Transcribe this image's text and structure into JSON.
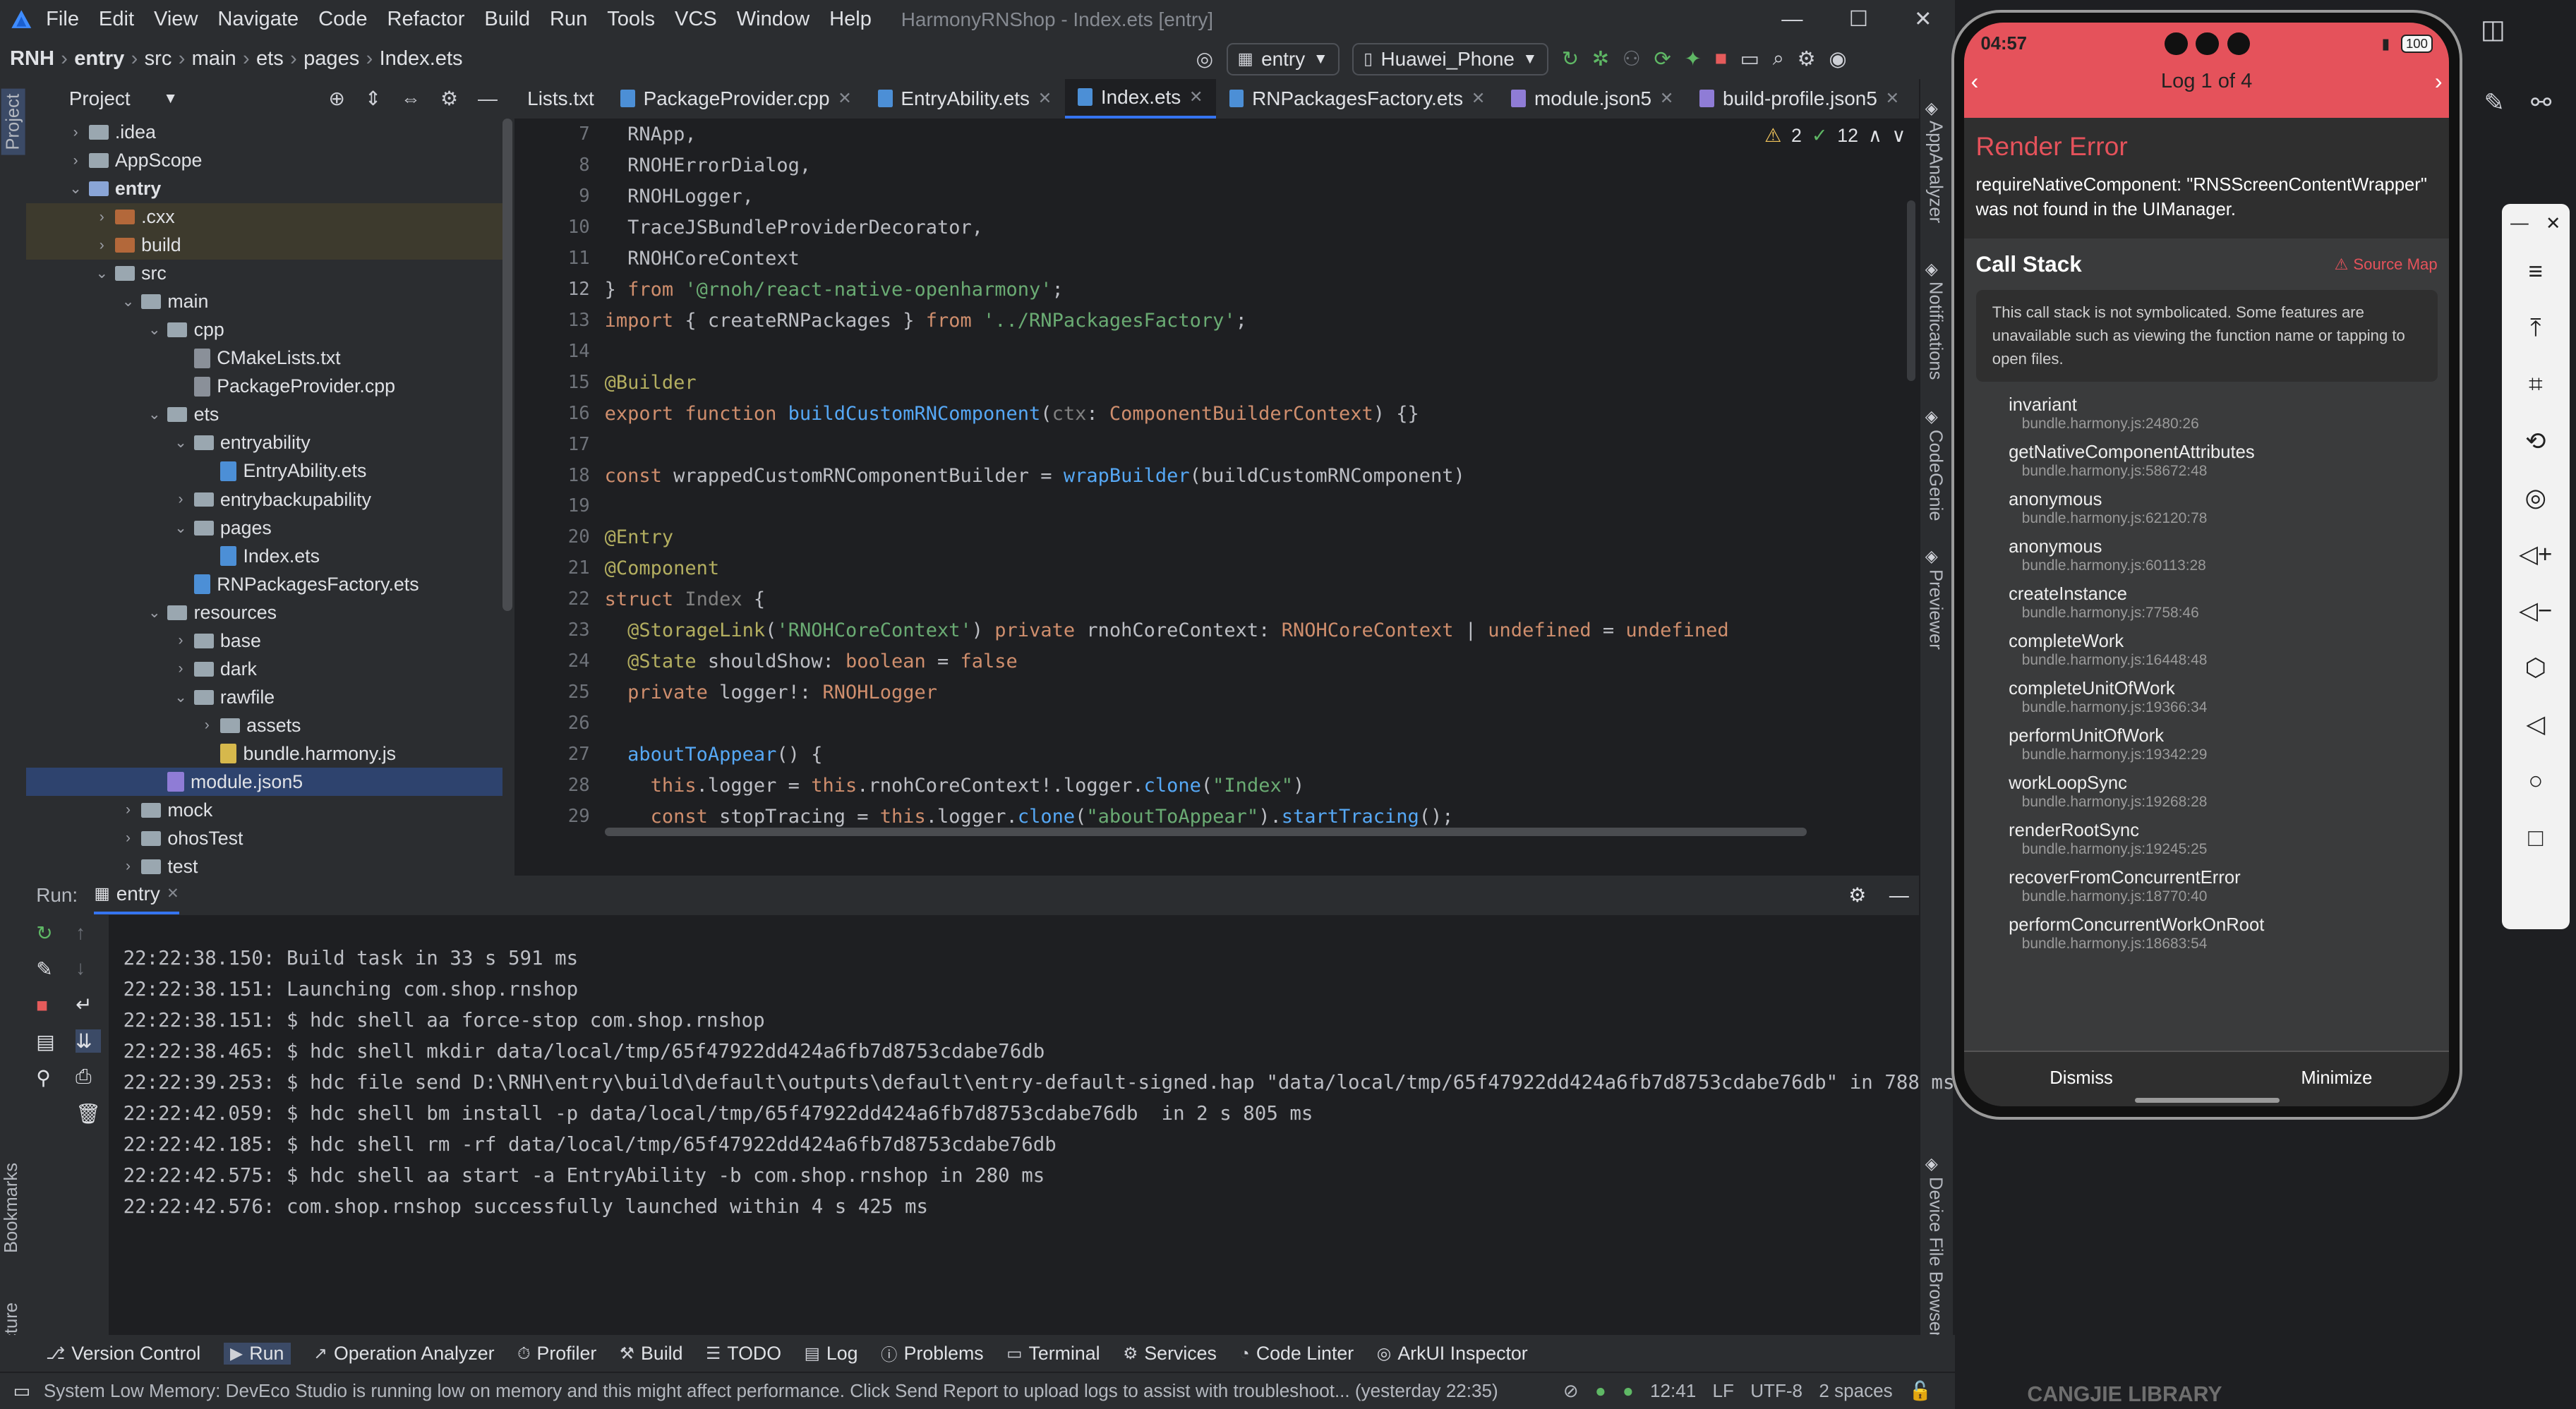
{
  "window": {
    "title": "HarmonyRNShop - Index.ets [entry]",
    "menu": [
      "File",
      "Edit",
      "View",
      "Navigate",
      "Code",
      "Refactor",
      "Build",
      "Run",
      "Tools",
      "VCS",
      "Window",
      "Help"
    ]
  },
  "breadcrumb": [
    "RNH",
    "entry",
    "src",
    "main",
    "ets",
    "pages",
    "Index.ets"
  ],
  "toolbar": {
    "run_config": "entry",
    "device": "Huawei_Phone"
  },
  "project": {
    "title": "Project",
    "tree": [
      {
        "label": ".idea",
        "depth": 1,
        "caret": "›",
        "kind": "folder"
      },
      {
        "label": "AppScope",
        "depth": 1,
        "caret": "›",
        "kind": "folder"
      },
      {
        "label": "entry",
        "depth": 1,
        "caret": "⌄",
        "kind": "module",
        "bold": true
      },
      {
        "label": ".cxx",
        "depth": 2,
        "caret": "›",
        "kind": "excluded"
      },
      {
        "label": "build",
        "depth": 2,
        "caret": "›",
        "kind": "excluded"
      },
      {
        "label": "src",
        "depth": 2,
        "caret": "⌄",
        "kind": "folder"
      },
      {
        "label": "main",
        "depth": 3,
        "caret": "⌄",
        "kind": "folder"
      },
      {
        "label": "cpp",
        "depth": 4,
        "caret": "⌄",
        "kind": "folder"
      },
      {
        "label": "CMakeLists.txt",
        "depth": 5,
        "caret": "",
        "kind": "file"
      },
      {
        "label": "PackageProvider.cpp",
        "depth": 5,
        "caret": "",
        "kind": "file"
      },
      {
        "label": "ets",
        "depth": 4,
        "caret": "⌄",
        "kind": "folder"
      },
      {
        "label": "entryability",
        "depth": 5,
        "caret": "⌄",
        "kind": "folder"
      },
      {
        "label": "EntryAbility.ets",
        "depth": 6,
        "caret": "",
        "kind": "file"
      },
      {
        "label": "entrybackupability",
        "depth": 5,
        "caret": "›",
        "kind": "folder"
      },
      {
        "label": "pages",
        "depth": 5,
        "caret": "⌄",
        "kind": "folder"
      },
      {
        "label": "Index.ets",
        "depth": 6,
        "caret": "",
        "kind": "file"
      },
      {
        "label": "RNPackagesFactory.ets",
        "depth": 5,
        "caret": "",
        "kind": "file"
      },
      {
        "label": "resources",
        "depth": 4,
        "caret": "⌄",
        "kind": "folder"
      },
      {
        "label": "base",
        "depth": 5,
        "caret": "›",
        "kind": "folder"
      },
      {
        "label": "dark",
        "depth": 5,
        "caret": "›",
        "kind": "folder"
      },
      {
        "label": "rawfile",
        "depth": 5,
        "caret": "⌄",
        "kind": "folder"
      },
      {
        "label": "assets",
        "depth": 6,
        "caret": "›",
        "kind": "folder"
      },
      {
        "label": "bundle.harmony.js",
        "depth": 6,
        "caret": "",
        "kind": "file"
      },
      {
        "label": "module.json5",
        "depth": 4,
        "caret": "",
        "kind": "file",
        "selected": true
      },
      {
        "label": "mock",
        "depth": 3,
        "caret": "›",
        "kind": "folder"
      },
      {
        "label": "ohosTest",
        "depth": 3,
        "caret": "›",
        "kind": "folder"
      },
      {
        "label": "test",
        "depth": 3,
        "caret": "›",
        "kind": "folder"
      }
    ]
  },
  "editor": {
    "tabs": [
      "Lists.txt",
      "PackageProvider.cpp",
      "EntryAbility.ets",
      "Index.ets",
      "RNPackagesFactory.ets",
      "module.json5",
      "build-profile.json5"
    ],
    "active_tab": "Index.ets",
    "inspections": {
      "warnings": "2",
      "ok": "12"
    },
    "lines": [
      {
        "n": "7",
        "html": "  <span class='plain'>RNApp,</span>"
      },
      {
        "n": "8",
        "html": "  <span class='plain'>RNOHErrorDialog,</span>"
      },
      {
        "n": "9",
        "html": "  <span class='plain'>RNOHLogger,</span>"
      },
      {
        "n": "10",
        "html": "  <span class='plain'>TraceJSBundleProviderDecorator,</span>"
      },
      {
        "n": "11",
        "html": "  <span class='plain'>RNOHCoreContext</span>"
      },
      {
        "n": "12",
        "html": "<span class='plain'>} </span><span class='kw'>from </span><span class='str'>'@rnoh/react-native-openharmony'</span><span class='plain'>;</span>"
      },
      {
        "n": "13",
        "html": "<span class='kw'>import </span><span class='plain'>{ createRNPackages } </span><span class='kw'>from </span><span class='str'>'../RNPackagesFactory'</span><span class='plain'>;</span>"
      },
      {
        "n": "14",
        "html": ""
      },
      {
        "n": "15",
        "html": "<span class='dec'>@Builder</span>"
      },
      {
        "n": "16",
        "html": "<span class='kw'>export function </span><span class='fn'>buildCustomRNComponent</span><span class='plain'>(</span><span class='par'>ctx</span><span class='plain'>: </span><span class='kw'>ComponentBuilderContext</span><span class='plain'>) {}</span>"
      },
      {
        "n": "17",
        "html": ""
      },
      {
        "n": "18",
        "html": "<span class='kw'>const </span><span class='plain'>wrappedCustomRNComponentBuilder = </span><span class='fn'>wrapBuilder</span><span class='plain'>(buildCustomRNComponent)</span>"
      },
      {
        "n": "19",
        "html": ""
      },
      {
        "n": "20",
        "html": "<span class='dec'>@Entry</span>"
      },
      {
        "n": "21",
        "html": "<span class='dec'>@Component</span>"
      },
      {
        "n": "22",
        "html": "<span class='kw'>struct </span><span class='par'>Index </span><span class='plain'>{</span>"
      },
      {
        "n": "23",
        "html": "  <span class='dec'>@StorageLink</span><span class='plain'>(</span><span class='str'>'RNOHCoreContext'</span><span class='plain'>) </span><span class='kw'>private </span><span class='plain'>rnohCoreContext: </span><span class='kw'>RNOHCoreContext </span><span class='plain'>| </span><span class='kw'>undefined </span><span class='plain'>= </span><span class='kw'>undefined</span>"
      },
      {
        "n": "24",
        "html": "  <span class='dec'>@State </span><span class='plain'>shouldShow: </span><span class='kw'>boolean </span><span class='plain'>= </span><span class='kw'>false</span>"
      },
      {
        "n": "25",
        "html": "  <span class='kw'>private </span><span class='plain'>logger!: </span><span class='kw'>RNOHLogger</span>"
      },
      {
        "n": "26",
        "html": ""
      },
      {
        "n": "27",
        "html": "  <span class='fn'>aboutToAppear</span><span class='plain'>() {</span>"
      },
      {
        "n": "28",
        "html": "    <span class='kw'>this</span><span class='plain'>.logger = </span><span class='kw'>this</span><span class='plain'>.rnohCoreContext!.logger.</span><span class='fn'>clone</span><span class='plain'>(</span><span class='str'>\"Index\"</span><span class='plain'>)</span>"
      },
      {
        "n": "29",
        "html": "    <span class='kw'>const </span><span class='plain'>stopTracing = </span><span class='kw'>this</span><span class='plain'>.logger.</span><span class='fn'>clone</span><span class='plain'>(</span><span class='str'>\"aboutToAppear\"</span><span class='plain'>).</span><span class='fn'>startTracing</span><span class='plain'>();</span>"
      }
    ]
  },
  "run": {
    "label": "Run:",
    "config": "entry",
    "log": [
      "22:22:38.150: Build task in 33 s 591 ms",
      "22:22:38.151: Launching com.shop.rnshop",
      "22:22:38.151: $ hdc shell aa force-stop com.shop.rnshop",
      "22:22:38.465: $ hdc shell mkdir data/local/tmp/65f47922dd424a6fb7d8753cdabe76db",
      "22:22:39.253: $ hdc file send D:\\RNH\\entry\\build\\default\\outputs\\default\\entry-default-signed.hap \"data/local/tmp/65f47922dd424a6fb7d8753cdabe76db\" in 788 ms",
      "22:22:42.059: $ hdc shell bm install -p data/local/tmp/65f47922dd424a6fb7d8753cdabe76db  in 2 s 805 ms",
      "22:22:42.185: $ hdc shell rm -rf data/local/tmp/65f47922dd424a6fb7d8753cdabe76db",
      "22:22:42.575: $ hdc shell aa start -a EntryAbility -b com.shop.rnshop in 280 ms",
      "22:22:42.576: com.shop.rnshop successfully launched within 4 s 425 ms"
    ]
  },
  "bottom_tabs": [
    "Version Control",
    "Run",
    "Operation Analyzer",
    "Profiler",
    "Build",
    "TODO",
    "Log",
    "Problems",
    "Terminal",
    "Services",
    "Code Linter",
    "ArkUI Inspector"
  ],
  "status": {
    "message": "System Low Memory: DevEco Studio is running low on memory and this might affect performance. Click Send Report to upload logs to assist with troubleshoot... (yesterday 22:35)",
    "position": "12:41",
    "line_sep": "LF",
    "encoding": "UTF-8",
    "indent": "2 spaces"
  },
  "left_stripe": {
    "project": "Project",
    "bookmarks": "Bookmarks",
    "structure": "Structure"
  },
  "right_stripe": [
    "AppAnalyzer",
    "Notifications",
    "CodeGenie",
    "Previewer",
    "Device File Browser"
  ],
  "phone": {
    "time": "04:57",
    "battery": "100",
    "log_nav": "Log 1 of 4",
    "error_title": "Render Error",
    "error_message": "requireNativeComponent: \"RNSScreenContentWrapper\" was not found in the UIManager.",
    "call_stack_title": "Call Stack",
    "source_map": "Source Map",
    "notice": "This call stack is not symbolicated. Some features are unavailable such as viewing the function name or tapping to open files.",
    "frames": [
      {
        "fn": "invariant",
        "loc": "bundle.harmony.js:2480:26"
      },
      {
        "fn": "getNativeComponentAttributes",
        "loc": "bundle.harmony.js:58672:48"
      },
      {
        "fn": "anonymous",
        "loc": "bundle.harmony.js:62120:78"
      },
      {
        "fn": "anonymous",
        "loc": "bundle.harmony.js:60113:28"
      },
      {
        "fn": "createInstance",
        "loc": "bundle.harmony.js:7758:46"
      },
      {
        "fn": "completeWork",
        "loc": "bundle.harmony.js:16448:48"
      },
      {
        "fn": "completeUnitOfWork",
        "loc": "bundle.harmony.js:19366:34"
      },
      {
        "fn": "performUnitOfWork",
        "loc": "bundle.harmony.js:19342:29"
      },
      {
        "fn": "workLoopSync",
        "loc": "bundle.harmony.js:19268:28"
      },
      {
        "fn": "renderRootSync",
        "loc": "bundle.harmony.js:19245:25"
      },
      {
        "fn": "recoverFromConcurrentError",
        "loc": "bundle.harmony.js:18770:40"
      },
      {
        "fn": "performConcurrentWorkOnRoot",
        "loc": "bundle.harmony.js:18683:54"
      }
    ],
    "dismiss": "Dismiss",
    "minimize": "Minimize"
  },
  "background_text": "CANGJIE LIBRARY",
  "colors": {
    "accent": "#3574f0",
    "error_header": "#e5525b",
    "selection": "#2e436e"
  }
}
